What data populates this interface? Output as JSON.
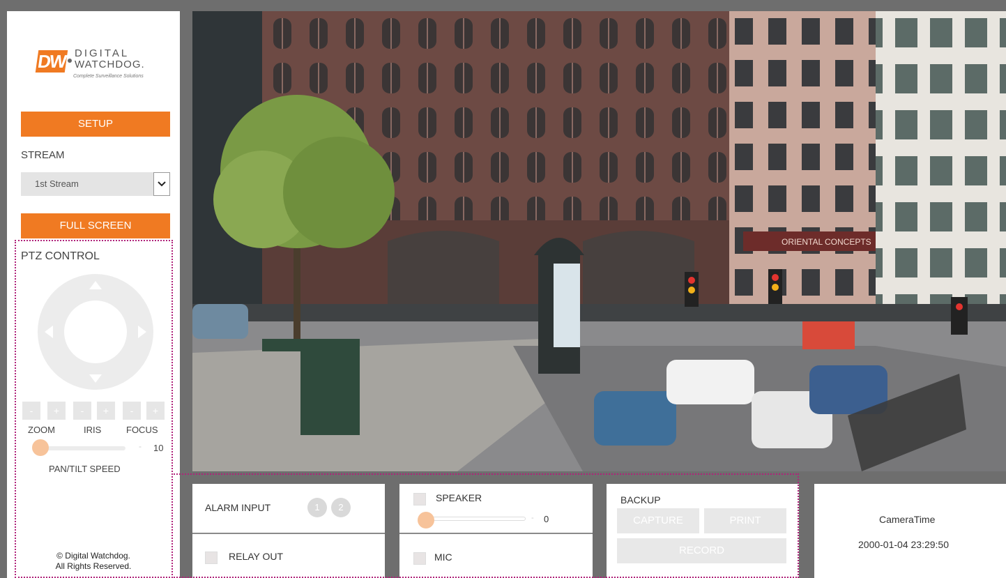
{
  "brand": {
    "logo_mark": "DW",
    "name_line1": "DIGITAL",
    "name_line2": "WATCHDOG.",
    "tagline": "Complete Surveillance Solutions"
  },
  "sidebar": {
    "setup_label": "SETUP",
    "stream_label": "STREAM",
    "stream_selected": "1st Stream",
    "fullscreen_label": "FULL SCREEN",
    "ptz": {
      "title": "PTZ CONTROL",
      "zoom_label": "ZOOM",
      "iris_label": "IRIS",
      "focus_label": "FOCUS",
      "minus": "-",
      "plus": "+",
      "speed_value": "10",
      "speed_label": "PAN/TILT SPEED"
    },
    "copyright_line1": "© Digital Watchdog.",
    "copyright_line2": "All Rights Reserved."
  },
  "camera_view": {
    "sign_text": "ORIENTAL CONCEPTS"
  },
  "bottom": {
    "alarm_input_label": "ALARM INPUT",
    "alarm_inputs": [
      "1",
      "2"
    ],
    "relay_out_label": "RELAY OUT",
    "speaker_label": "SPEAKER",
    "speaker_value": "0",
    "mic_label": "MIC",
    "backup_label": "BACKUP",
    "capture_label": "CAPTURE",
    "print_label": "PRINT",
    "record_label": "RECORD",
    "camera_time_label": "CameraTime",
    "camera_time_value": "2000-01-04 23:29:50"
  },
  "colors": {
    "accent": "#f07a22",
    "accent_light": "#f7c39a",
    "frame": "#6e6e6e",
    "highlight_border": "#b0237a"
  }
}
